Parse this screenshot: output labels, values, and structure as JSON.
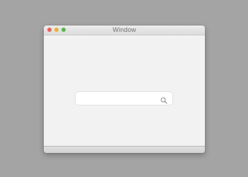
{
  "window": {
    "title": "Window"
  },
  "search": {
    "value": "",
    "placeholder": "",
    "icon": "search-icon"
  },
  "colors": {
    "close": "#ec5f57",
    "minimize": "#e8b13b",
    "maximize": "#57b94a"
  }
}
